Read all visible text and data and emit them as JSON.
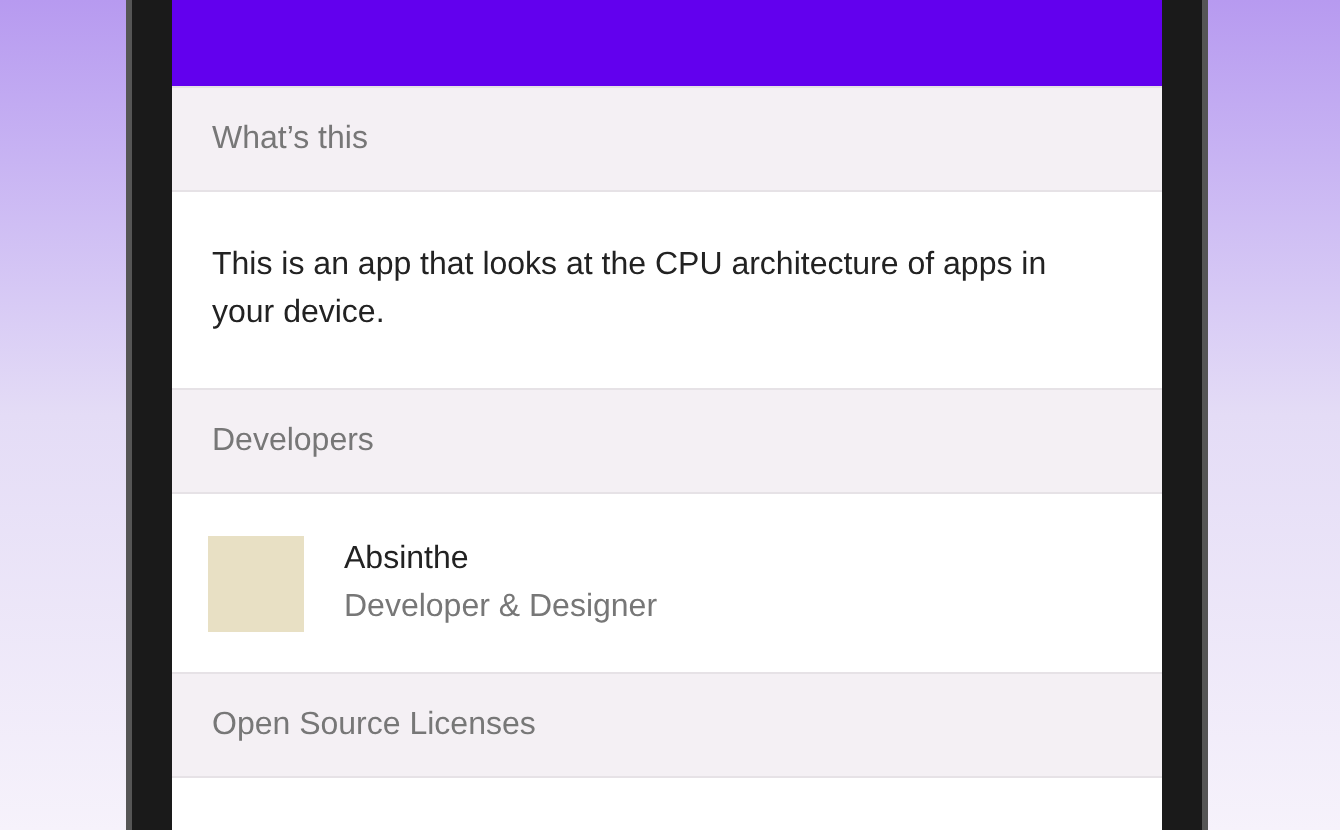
{
  "sections": [
    {
      "header": "What’s this",
      "kind": "text",
      "body": "This is an app that looks at the CPU architecture of apps in your device."
    },
    {
      "header": "Developers",
      "kind": "people",
      "people": [
        {
          "name": "Absinthe",
          "role": "Developer & Designer"
        }
      ]
    },
    {
      "header": "Open Source Licenses",
      "kind": "empty"
    }
  ]
}
